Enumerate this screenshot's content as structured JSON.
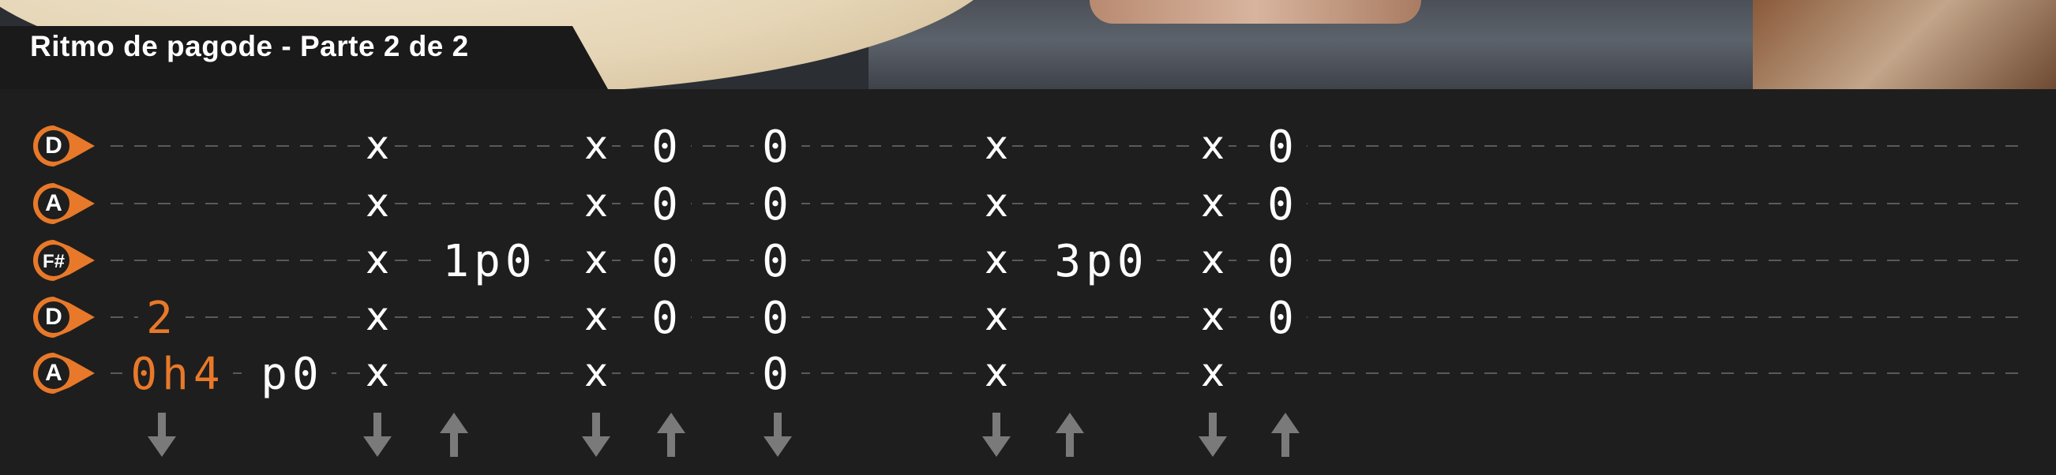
{
  "title": "Ritmo de pagode - Parte 2 de 2",
  "colors": {
    "accent": "#e8792a",
    "text": "#ffffff",
    "background": "#1e1e1e",
    "line": "#5a5a5a",
    "arrow": "#7a7a7a"
  },
  "strings": [
    {
      "name": "D",
      "notes": [
        {
          "c": "x"
        },
        {
          "c": "x"
        },
        {
          "c": "0"
        },
        {
          "c": "0"
        },
        {
          "c": "x"
        },
        {
          "c": "x"
        },
        {
          "c": "0"
        }
      ]
    },
    {
      "name": "A",
      "notes": [
        {
          "c": "x"
        },
        {
          "c": "x"
        },
        {
          "c": "0"
        },
        {
          "c": "0"
        },
        {
          "c": "x"
        },
        {
          "c": "x"
        },
        {
          "c": "0"
        }
      ]
    },
    {
      "name": "F#",
      "notes": [
        {
          "c": "x"
        },
        {
          "c": "1p0"
        },
        {
          "c": "x"
        },
        {
          "c": "0"
        },
        {
          "c": "0"
        },
        {
          "c": "x"
        },
        {
          "c": "3p0"
        },
        {
          "c": "x"
        },
        {
          "c": "0"
        }
      ]
    },
    {
      "name": "D",
      "notes": [
        {
          "c": "2",
          "orange": true
        },
        {
          "c": "x"
        },
        {
          "c": "x"
        },
        {
          "c": "0"
        },
        {
          "c": "0"
        },
        {
          "c": "x"
        },
        {
          "c": "x"
        },
        {
          "c": "0"
        }
      ]
    },
    {
      "name": "A",
      "notes": [
        {
          "c": "0h4",
          "orange": true
        },
        {
          "c": "p0"
        },
        {
          "c": "x"
        },
        {
          "c": "x"
        },
        {
          "c": "0"
        },
        {
          "c": "x"
        },
        {
          "c": "x"
        }
      ]
    }
  ],
  "strums": [
    "down",
    "down",
    "up",
    "down",
    "up",
    "down",
    "down",
    "up",
    "down",
    "up"
  ],
  "icons": {
    "string_badge": "string-badge-icon",
    "strum_down": "arrow-down-icon",
    "strum_up": "arrow-up-icon"
  }
}
